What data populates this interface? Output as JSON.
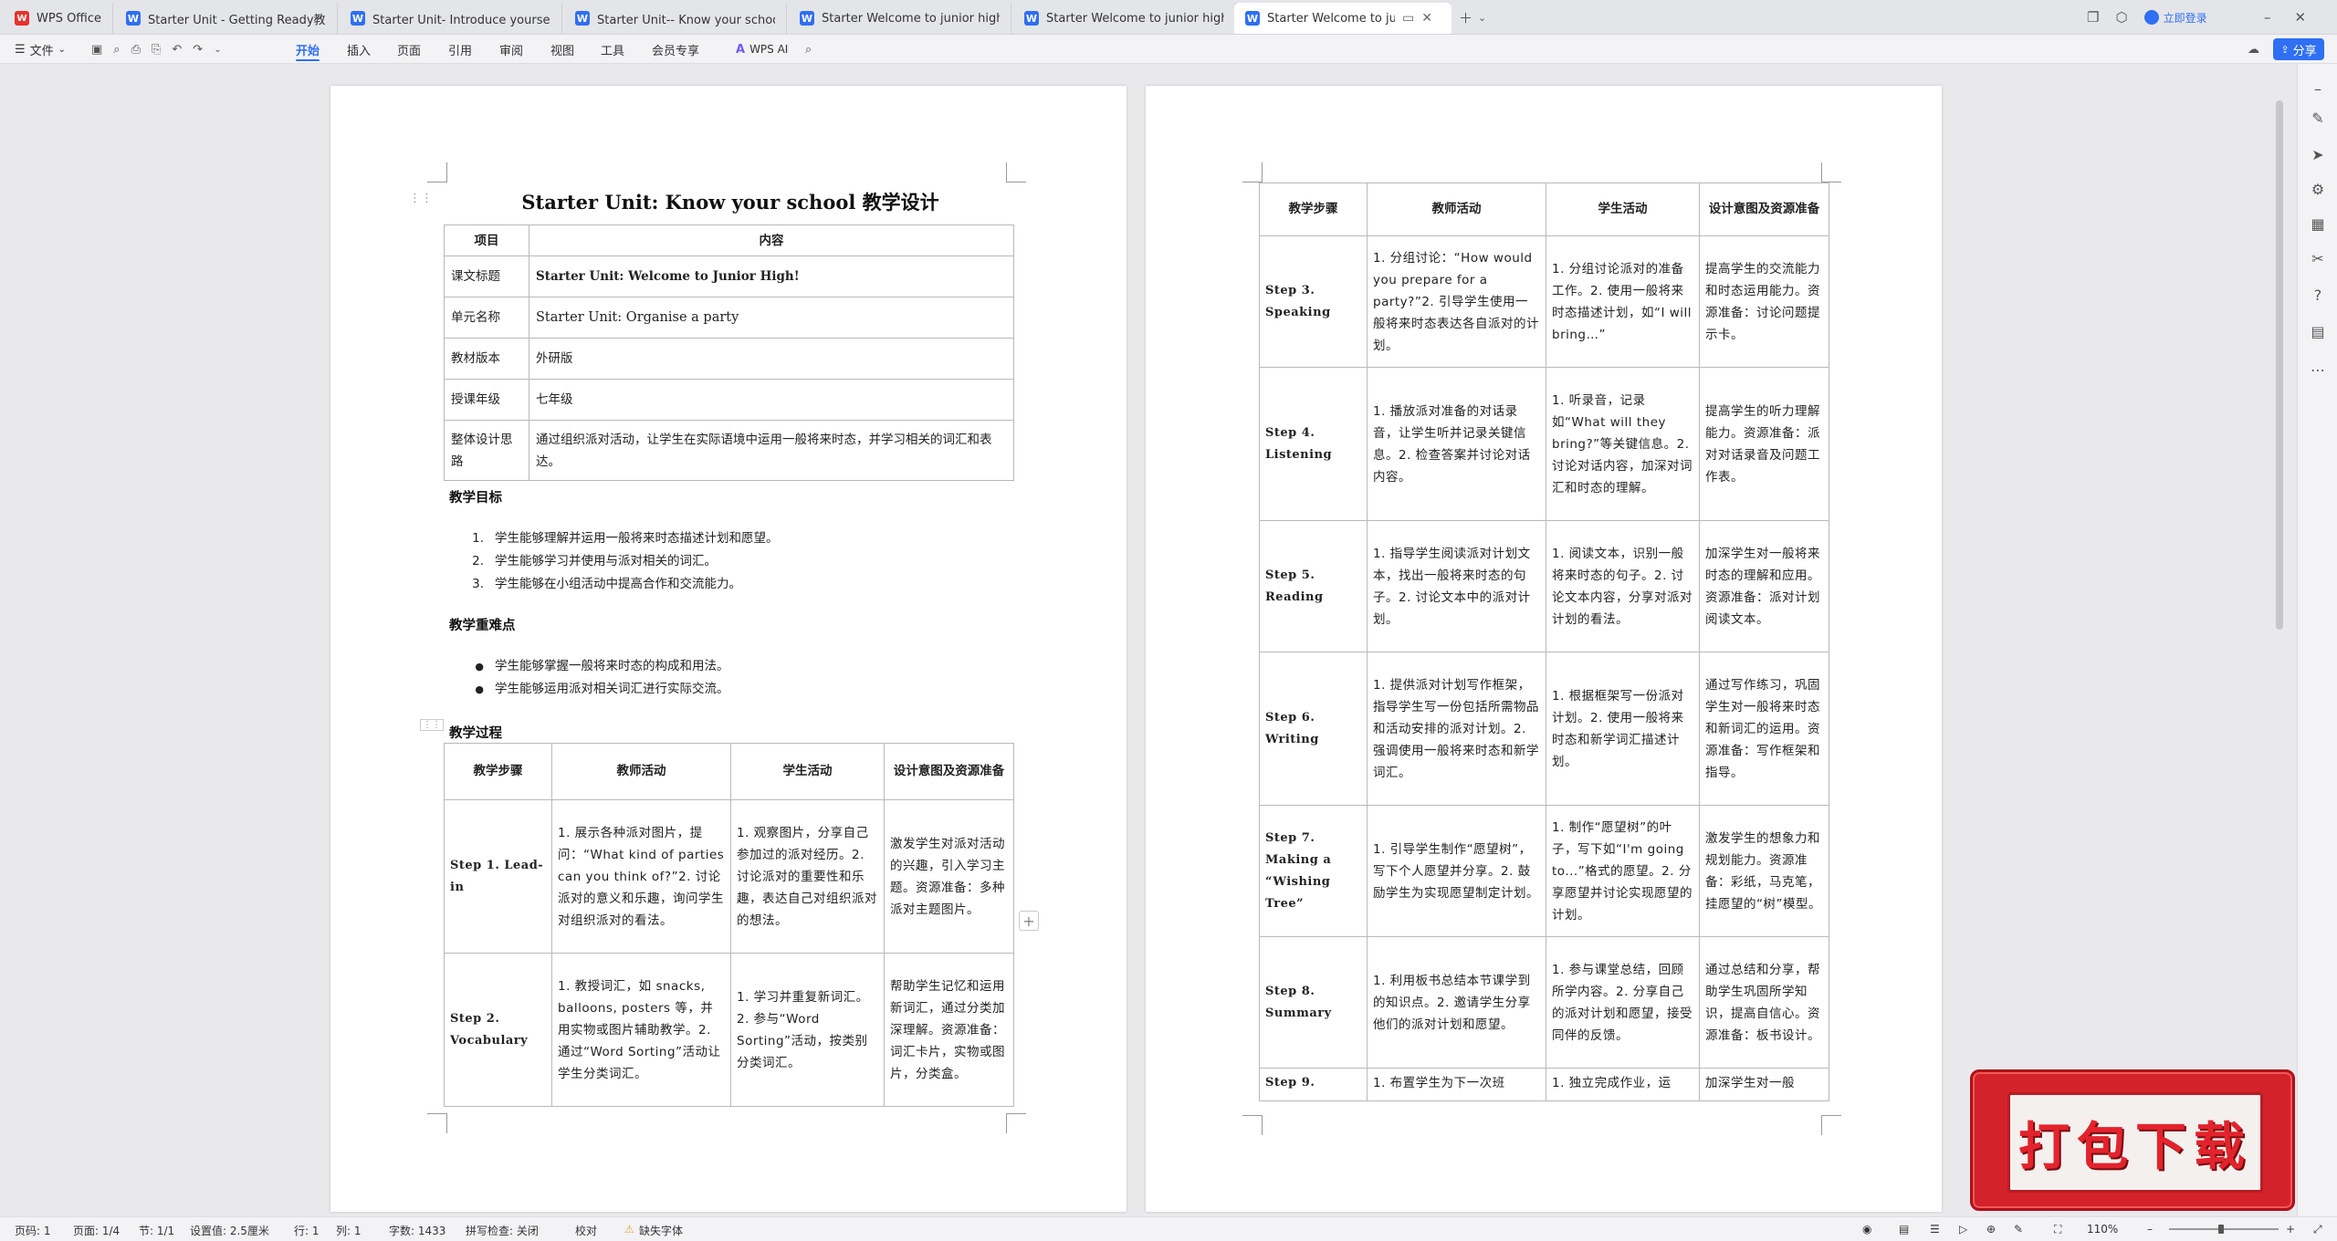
{
  "tabs": [
    {
      "label": "WPS Office",
      "logo": "wps"
    },
    {
      "label": "Starter Unit - Getting Ready教学设",
      "logo": "W"
    },
    {
      "label": "Starter Unit- Introduce yourself教",
      "logo": "W"
    },
    {
      "label": "Starter Unit-- Know your school教",
      "logo": "W"
    },
    {
      "label": "Starter Welcome to junior high! C",
      "logo": "W"
    },
    {
      "label": "Starter Welcome to junior high!",
      "logo": "W"
    },
    {
      "label": "Starter Welcome to junior hi",
      "logo": "W"
    }
  ],
  "titlebar": {
    "login": "立即登录"
  },
  "ribbon": {
    "file": "文件",
    "menus": [
      "开始",
      "插入",
      "页面",
      "引用",
      "审阅",
      "视图",
      "工具",
      "会员专享"
    ],
    "active_menu": "开始",
    "ai": "WPS AI",
    "share": "分享"
  },
  "page1": {
    "title": "Starter Unit: Know your school 教学设计",
    "info_headers": [
      "项目",
      "内容"
    ],
    "info_rows": [
      {
        "label": "课文标题",
        "value": "Starter Unit: Welcome to Junior High!"
      },
      {
        "label": "单元名称",
        "value": "Starter Unit: Organise a party"
      },
      {
        "label": "教材版本",
        "value": "外研版"
      },
      {
        "label": "授课年级",
        "value": "七年级"
      },
      {
        "label": "整体设计思路",
        "value": "通过组织派对活动，让学生在实际语境中运用一般将来时态，并学习相关的词汇和表达。"
      }
    ],
    "objectives_heading": "教学目标",
    "objectives": [
      "学生能够理解并运用一般将来时态描述计划和愿望。",
      "学生能够学习并使用与派对相关的词汇。",
      "学生能够在小组活动中提高合作和交流能力。"
    ],
    "keypoints_heading": "教学重难点",
    "keypoints": [
      "学生能够掌握一般将来时态的构成和用法。",
      "学生能够运用派对相关词汇进行实际交流。"
    ],
    "process_heading": "教学过程",
    "process_headers": [
      "教学步骤",
      "教师活动",
      "学生活动",
      "设计意图及资源准备"
    ],
    "process_rows": [
      {
        "step": "Step 1. Lead-in",
        "teacher": "1. 展示各种派对图片，提问：“What kind of parties can you think of?”2. 讨论派对的意义和乐趣，询问学生对组织派对的看法。",
        "student": "1. 观察图片，分享自己参加过的派对经历。2. 讨论派对的重要性和乐趣，表达自己对组织派对的想法。",
        "intent": "激发学生对派对活动的兴趣，引入学习主题。资源准备：多种派对主题图片。"
      },
      {
        "step": "Step 2. Vocabulary",
        "teacher": "1. 教授词汇，如 snacks, balloons, posters 等，并用实物或图片辅助教学。2. 通过“Word Sorting”活动让学生分类词汇。",
        "student": "1. 学习并重复新词汇。2. 参与“Word Sorting”活动，按类别分类词汇。",
        "intent": "帮助学生记忆和运用新词汇，通过分类加深理解。资源准备：词汇卡片，实物或图片，分类盒。"
      }
    ]
  },
  "page2": {
    "process_headers": [
      "教学步骤",
      "教师活动",
      "学生活动",
      "设计意图及资源准备"
    ],
    "process_rows": [
      {
        "step": "Step 3. Speaking",
        "teacher": "1. 分组讨论：“How would you prepare for a party?”2. 引导学生使用一般将来时态表达各自派对的计划。",
        "student": "1. 分组讨论派对的准备工作。2. 使用一般将来时态描述计划，如“I will bring…”",
        "intent": "提高学生的交流能力和时态运用能力。资源准备：讨论问题提示卡。"
      },
      {
        "step": "Step 4. Listening",
        "teacher": "1. 播放派对准备的对话录音，让学生听并记录关键信息。2. 检查答案并讨论对话内容。",
        "student": "1. 听录音，记录如“What will they bring?”等关键信息。2. 讨论对话内容，加深对词汇和时态的理解。",
        "intent": "提高学生的听力理解能力。资源准备：派对对话录音及问题工作表。"
      },
      {
        "step": "Step 5. Reading",
        "teacher": "1. 指导学生阅读派对计划文本，找出一般将来时态的句子。2. 讨论文本中的派对计划。",
        "student": "1. 阅读文本，识别一般将来时态的句子。2. 讨论文本内容，分享对派对计划的看法。",
        "intent": "加深学生对一般将来时态的理解和应用。资源准备：派对计划阅读文本。"
      },
      {
        "step": "Step 6. Writing",
        "teacher": "1. 提供派对计划写作框架，指导学生写一份包括所需物品和活动安排的派对计划。2. 强调使用一般将来时态和新学词汇。",
        "student": "1. 根据框架写一份派对计划。2. 使用一般将来时态和新学词汇描述计划。",
        "intent": "通过写作练习，巩固学生对一般将来时态和新词汇的运用。资源准备：写作框架和指导。"
      },
      {
        "step": "Step 7. Making a “Wishing Tree”",
        "teacher": "1. 引导学生制作“愿望树”，写下个人愿望并分享。2. 鼓励学生为实现愿望制定计划。",
        "student": "1. 制作“愿望树”的叶子，写下如“I'm going to...”格式的愿望。2. 分享愿望并讨论实现愿望的计划。",
        "intent": "激发学生的想象力和规划能力。资源准备：彩纸，马克笔，挂愿望的“树”模型。"
      },
      {
        "step": "Step 8. Summary",
        "teacher": "1. 利用板书总结本节课学到的知识点。2. 邀请学生分享他们的派对计划和愿望。",
        "student": "1. 参与课堂总结，回顾所学内容。2. 分享自己的派对计划和愿望，接受同伴的反馈。",
        "intent": "通过总结和分享，帮助学生巩固所学知识，提高自信心。资源准备：板书设计。"
      },
      {
        "step": "Step 9.",
        "teacher": "1. 布置学生为下一次班",
        "student": "1. 独立完成作业，运",
        "intent": "加深学生对一般"
      }
    ]
  },
  "statusbar": {
    "page": "页码: 1",
    "pages": "页面: 1/4",
    "section": "节: 1/1",
    "setting": "设置值: 2.5厘米",
    "row": "行: 1",
    "col": "列: 1",
    "words": "字数: 1433",
    "spell": "拼写检查: 关闭",
    "proof": "校对",
    "missing_font": "缺失字体",
    "zoom": "110%"
  },
  "banner": {
    "text": "打包下载"
  },
  "colors": {
    "accent": "#2f6ff2",
    "banner_red": "#d4222a"
  }
}
